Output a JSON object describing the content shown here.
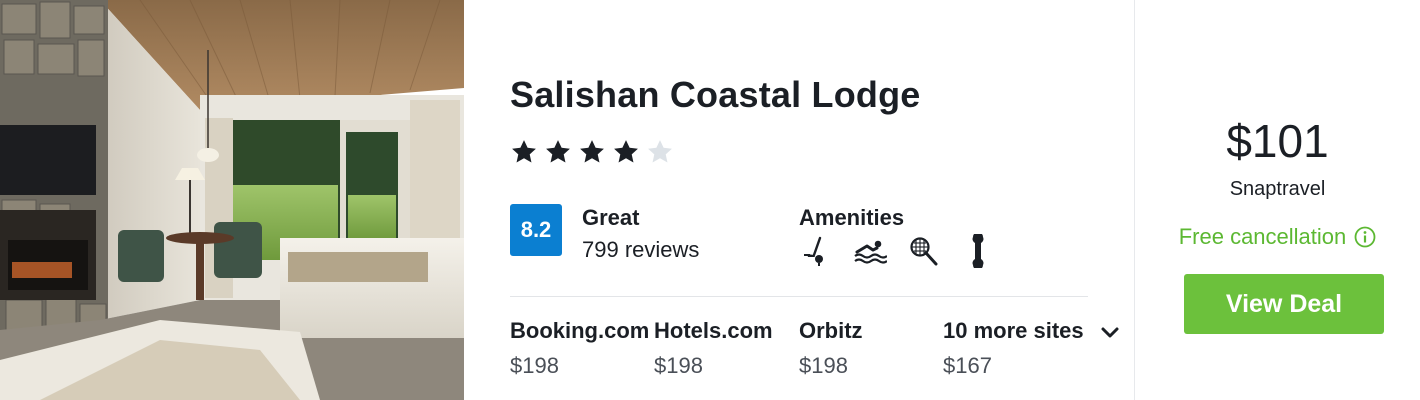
{
  "hotel": {
    "name": "Salishan Coastal Lodge",
    "star_rating": 4,
    "star_max": 5
  },
  "rating": {
    "score": "8.2",
    "label": "Great",
    "reviews": "799 reviews",
    "badge_color": "#0b7fd1"
  },
  "amenities": {
    "label": "Amenities",
    "icons": [
      "golf-icon",
      "swimming-icon",
      "tennis-icon",
      "pet-friendly-icon"
    ]
  },
  "sites": [
    {
      "name": "Booking.com",
      "price": "$198"
    },
    {
      "name": "Hotels.com",
      "price": "$198"
    },
    {
      "name": "Orbitz",
      "price": "$198"
    },
    {
      "name": "10 more sites",
      "price": "$167"
    }
  ],
  "deal": {
    "price": "$101",
    "provider": "Snaptravel",
    "cancellation": "Free cancellation",
    "button_label": "View Deal",
    "accent_color": "#6cc13c"
  }
}
